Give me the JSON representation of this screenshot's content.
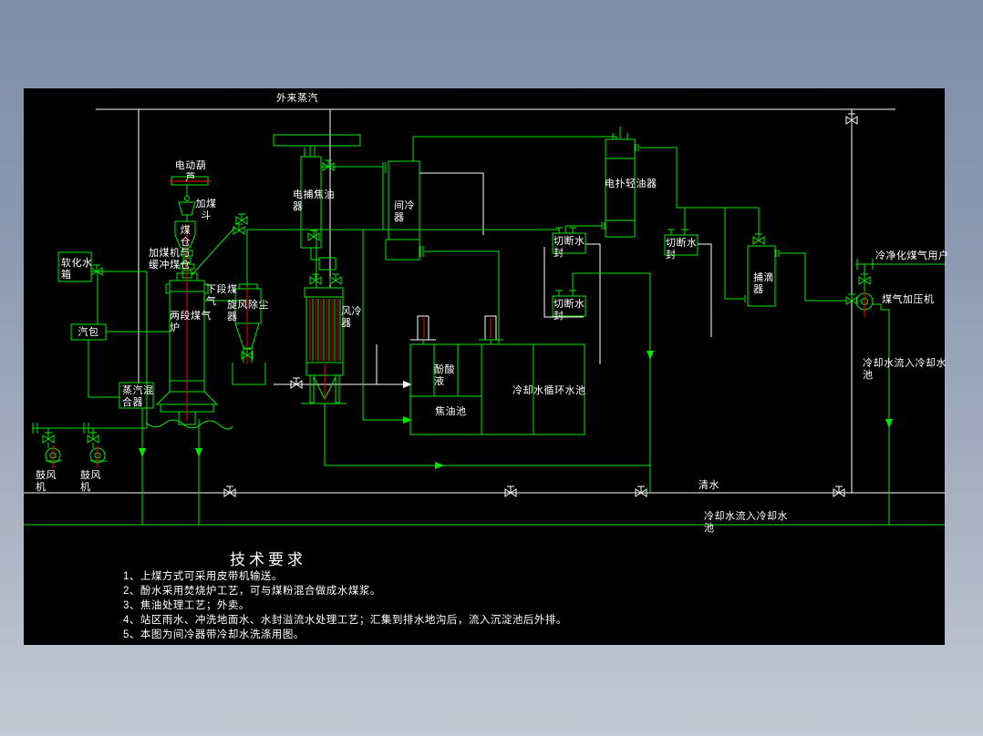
{
  "colors": {
    "pipe_green": "#00e800",
    "line_white": "#ffffff",
    "accent_red": "#ff0000",
    "canvas_black": "#000000",
    "frame_top": "#7f8ea9",
    "frame_bottom": "#c4c9d4"
  },
  "header": {
    "steam_label": "外来蒸汽"
  },
  "labels": {
    "hoist": "电动葫芦",
    "coal_hopper": "加煤斗",
    "coal_bunker": "煤仓",
    "coal_feeder": "加煤机与缓冲煤仓",
    "soft_water_tank": "软化水箱",
    "steam_drum": "汽包",
    "steam_mixer": "蒸汽混合器",
    "furnace": "两段煤气炉",
    "lower_gas": "下段煤气",
    "cyclone": "旋风除尘器",
    "air_cooler": "风冷器",
    "tar_esp": "电捕焦油器",
    "inter_cooler": "间冷器",
    "light_oil_esp": "电扑轻油器",
    "cutoff_seal_a": "切断水封",
    "cutoff_seal_b": "切断水封",
    "cutoff_seal_c": "切断水封",
    "drip_catcher": "捕滴器",
    "blower_1": "鼓风机",
    "blower_2": "鼓风机",
    "phenol_liquid": "酚酸液",
    "tar_pool": "焦油池",
    "cooling_pool": "冷却水循环水池",
    "gas_users": "冷净化煤气用户",
    "gas_compressor": "煤气加压机",
    "cooling_into_pool_right": "冷却水流入冷却水池",
    "clean_water": "清水",
    "cooling_into_pool_bottom": "冷却水流入冷却水池"
  },
  "notes": {
    "title": "技术要求",
    "items": [
      "1、上煤方式可采用皮带机输送。",
      "2、酚水采用焚烧炉工艺，可与煤粉混合做成水煤浆。",
      "3、焦油处理工艺；外卖。",
      "4、站区雨水、冲洗地面水、水封溢流水处理工艺；汇集到排水地沟后，流入沉淀池后外排。",
      "5、本图为间冷器带冷却水洗涤用图。"
    ]
  }
}
